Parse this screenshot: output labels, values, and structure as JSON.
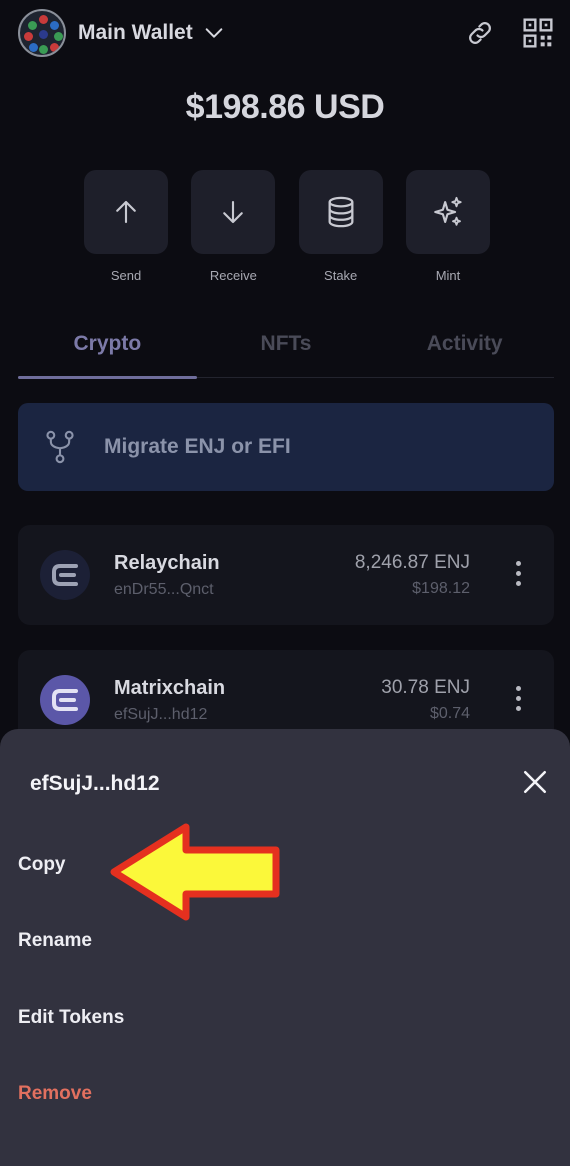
{
  "header": {
    "wallet_name": "Main Wallet",
    "icons": [
      "chevron-down-icon",
      "link-icon",
      "qr-code-icon"
    ]
  },
  "balance": "$198.86 USD",
  "actions": [
    {
      "label": "Send",
      "icon": "arrow-up-icon"
    },
    {
      "label": "Receive",
      "icon": "arrow-down-icon"
    },
    {
      "label": "Stake",
      "icon": "database-icon"
    },
    {
      "label": "Mint",
      "icon": "sparkles-icon"
    }
  ],
  "tabs": [
    {
      "label": "Crypto",
      "active": true
    },
    {
      "label": "NFTs",
      "active": false
    },
    {
      "label": "Activity",
      "active": false
    }
  ],
  "migrate": {
    "label": "Migrate ENJ or EFI",
    "icon": "fork-icon"
  },
  "tokens": [
    {
      "name": "Relaychain",
      "address": "enDr55...Qnct",
      "amount": "8,246.87 ENJ",
      "usd": "$198.12",
      "logo_color": "#1c2036"
    },
    {
      "name": "Matrixchain",
      "address": "efSujJ...hd12",
      "amount": "30.78 ENJ",
      "usd": "$0.74",
      "logo_color": "#5b57a8"
    }
  ],
  "sheet": {
    "title": "efSujJ...hd12",
    "items": [
      {
        "label": "Copy",
        "danger": false
      },
      {
        "label": "Rename",
        "danger": false
      },
      {
        "label": "Edit Tokens",
        "danger": false
      },
      {
        "label": "Remove",
        "danger": true
      }
    ]
  },
  "colors": {
    "background": "#0c0c12",
    "accent_tab": "#7c7aa8",
    "migrate_bg": "#1b2541",
    "sheet_bg": "#32323f",
    "danger": "#e2705f",
    "annotation_arrow_fill": "#fbf83a",
    "annotation_arrow_stroke": "#e5301f"
  }
}
